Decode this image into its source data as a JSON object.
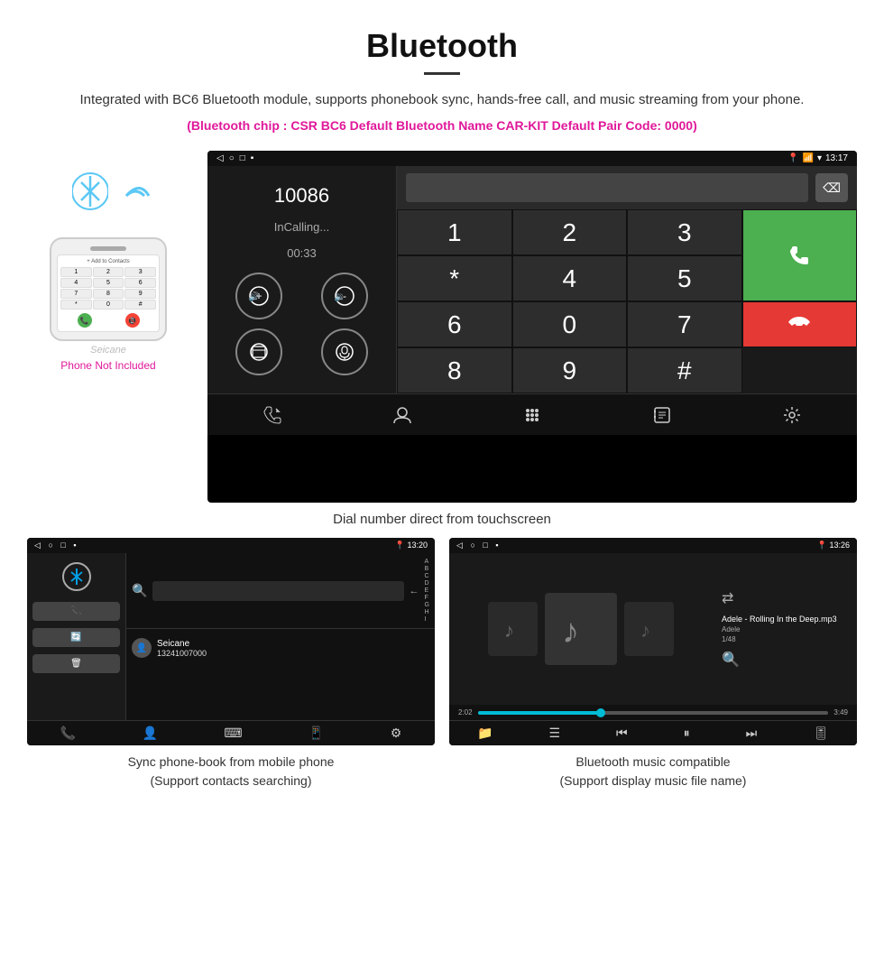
{
  "page": {
    "title": "Bluetooth",
    "divider": true,
    "description": "Integrated with BC6 Bluetooth module, supports phonebook sync, hands-free call, and music streaming from your phone.",
    "specs": "(Bluetooth chip : CSR BC6    Default Bluetooth Name CAR-KIT    Default Pair Code: 0000)"
  },
  "main_screenshot": {
    "status_bar": {
      "left_icons": [
        "back-arrow",
        "home-circle",
        "square"
      ],
      "right_icons": [
        "notification-dot",
        "location-pin",
        "phone",
        "wifi",
        "battery"
      ],
      "time": "13:17"
    },
    "dialer": {
      "number": "10086",
      "status": "InCalling...",
      "call_time": "00:33",
      "numpad": [
        "1",
        "2",
        "3",
        "*",
        "4",
        "5",
        "6",
        "0",
        "7",
        "8",
        "9",
        "#"
      ]
    },
    "nav_icons": [
      "call-transfer",
      "contacts",
      "dialpad",
      "phone-transfer",
      "settings"
    ]
  },
  "main_caption": "Dial number direct from touchscreen",
  "phonebook_screenshot": {
    "status_bar_time": "13:20",
    "contact_name": "Seicane",
    "contact_number": "13241007000",
    "alpha_list": [
      "A",
      "B",
      "C",
      "D",
      "E",
      "F",
      "G",
      "H",
      "I"
    ]
  },
  "phonebook_caption_line1": "Sync phone-book from mobile phone",
  "phonebook_caption_line2": "(Support contacts searching)",
  "music_screenshot": {
    "status_bar_time": "13:26",
    "song_title": "Adele - Rolling In the Deep.mp3",
    "artist": "Adele",
    "track_info": "1/48",
    "time_current": "2:02",
    "time_total": "3:49",
    "progress_percent": 35
  },
  "music_caption_line1": "Bluetooth music compatible",
  "music_caption_line2": "(Support display music file name)",
  "phone_not_included": "Phone Not Included",
  "seicane_watermark": "Seicane",
  "colors": {
    "accent_pink": "#e0189a",
    "green_call": "#4CAF50",
    "red_end": "#e53935",
    "blue_bt": "#00a0e9"
  }
}
